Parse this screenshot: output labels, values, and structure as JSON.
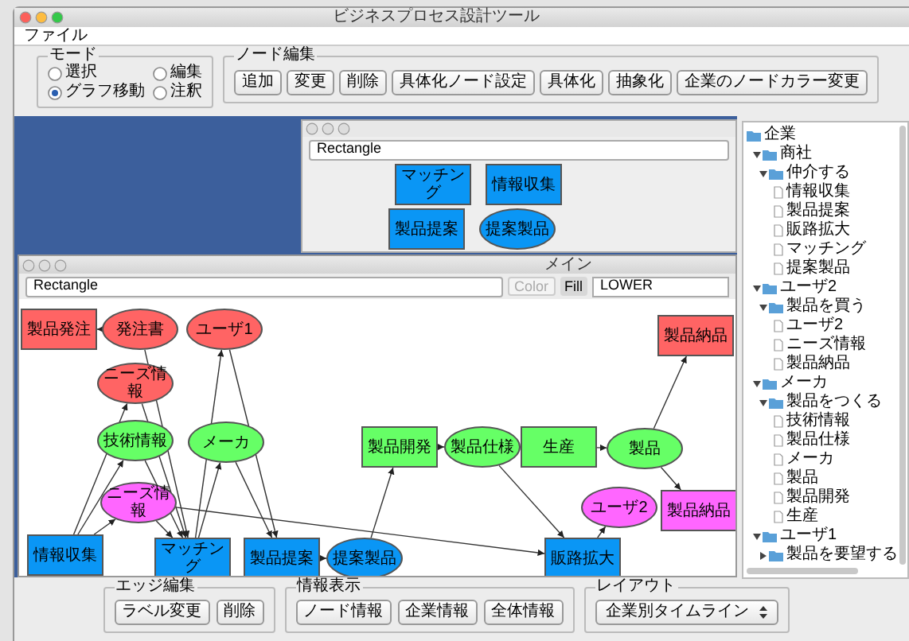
{
  "window": {
    "title": "ビジネスプロセス設計ツール"
  },
  "menu": [
    "ファイル"
  ],
  "mode": {
    "label": "モード",
    "options": [
      {
        "label": "選択",
        "selected": false
      },
      {
        "label": "編集",
        "selected": false
      },
      {
        "label": "グラフ移動",
        "selected": true
      },
      {
        "label": "注釈",
        "selected": false
      }
    ]
  },
  "node_edit": {
    "label": "ノード編集",
    "buttons": [
      "追加",
      "変更",
      "削除",
      "具体化ノード設定",
      "具体化",
      "抽象化",
      "企業のノードカラー変更"
    ]
  },
  "back_frame": {
    "shape": "Rectangle",
    "nodes": [
      {
        "label": "マッチング",
        "kind": "rect",
        "color": "#0a96f5"
      },
      {
        "label": "情報収集",
        "kind": "rect",
        "color": "#0a96f5"
      },
      {
        "label": "製品提案",
        "kind": "rect",
        "color": "#0a96f5"
      },
      {
        "label": "提案製品",
        "kind": "ellipse",
        "color": "#0a96f5"
      }
    ]
  },
  "main_frame": {
    "title": "メイン",
    "shape": "Rectangle",
    "color_button": {
      "label": "Color",
      "disabled": true
    },
    "fill_button": "Fill",
    "layer": "LOWER",
    "nodes": [
      {
        "label": "製品発注",
        "kind": "rect",
        "color": "#ff6464"
      },
      {
        "label": "発注書",
        "kind": "ellipse",
        "color": "#ff6464"
      },
      {
        "label": "ユーザ1",
        "kind": "ellipse",
        "color": "#ff6464"
      },
      {
        "label": "製品納品",
        "kind": "rect",
        "color": "#ff6464"
      },
      {
        "label": "ニーズ情報",
        "kind": "ellipse",
        "color": "#ff6464"
      },
      {
        "label": "技術情報",
        "kind": "ellipse",
        "color": "#66ff66"
      },
      {
        "label": "メーカ",
        "kind": "ellipse",
        "color": "#66ff66"
      },
      {
        "label": "製品開発",
        "kind": "rect",
        "color": "#66ff66"
      },
      {
        "label": "製品仕様",
        "kind": "ellipse",
        "color": "#66ff66"
      },
      {
        "label": "生産",
        "kind": "rect",
        "color": "#66ff66"
      },
      {
        "label": "製品",
        "kind": "ellipse",
        "color": "#66ff66"
      },
      {
        "label": "ニーズ情報",
        "kind": "ellipse",
        "color": "#ff66ff"
      },
      {
        "label": "ユーザ2",
        "kind": "ellipse",
        "color": "#ff66ff"
      },
      {
        "label": "製品納品",
        "kind": "rect",
        "color": "#ff66ff"
      },
      {
        "label": "情報収集",
        "kind": "rect",
        "color": "#0a96f5"
      },
      {
        "label": "マッチング",
        "kind": "rect",
        "color": "#0a96f5"
      },
      {
        "label": "製品提案",
        "kind": "rect",
        "color": "#0a96f5"
      },
      {
        "label": "提案製品",
        "kind": "ellipse",
        "color": "#0a96f5"
      },
      {
        "label": "販路拡大",
        "kind": "rect",
        "color": "#0a96f5"
      }
    ]
  },
  "tree": {
    "label": "企業",
    "kind": "folder",
    "children": [
      {
        "label": "商社",
        "kind": "folder",
        "expanded": true,
        "children": [
          {
            "label": "仲介する",
            "kind": "folder",
            "expanded": true,
            "children": [
              {
                "label": "情報収集",
                "kind": "leaf"
              },
              {
                "label": "製品提案",
                "kind": "leaf"
              },
              {
                "label": "販路拡大",
                "kind": "leaf"
              },
              {
                "label": "マッチング",
                "kind": "leaf"
              },
              {
                "label": "提案製品",
                "kind": "leaf"
              }
            ]
          }
        ]
      },
      {
        "label": "ユーザ2",
        "kind": "folder",
        "expanded": true,
        "children": [
          {
            "label": "製品を買う",
            "kind": "folder",
            "expanded": true,
            "children": [
              {
                "label": "ユーザ2",
                "kind": "leaf"
              },
              {
                "label": "ニーズ情報",
                "kind": "leaf"
              },
              {
                "label": "製品納品",
                "kind": "leaf"
              }
            ]
          }
        ]
      },
      {
        "label": "メーカ",
        "kind": "folder",
        "expanded": true,
        "children": [
          {
            "label": "製品をつくる",
            "kind": "folder",
            "expanded": true,
            "children": [
              {
                "label": "技術情報",
                "kind": "leaf"
              },
              {
                "label": "製品仕様",
                "kind": "leaf"
              },
              {
                "label": "メーカ",
                "kind": "leaf"
              },
              {
                "label": "製品",
                "kind": "leaf"
              },
              {
                "label": "製品開発",
                "kind": "leaf"
              },
              {
                "label": "生産",
                "kind": "leaf"
              }
            ]
          }
        ]
      },
      {
        "label": "ユーザ1",
        "kind": "folder",
        "expanded": true,
        "children": [
          {
            "label": "製品を要望する",
            "kind": "folder",
            "expanded": false
          }
        ]
      }
    ]
  },
  "edge_edit": {
    "label": "エッジ編集",
    "buttons": [
      "ラベル変更",
      "削除"
    ]
  },
  "info": {
    "label": "情報表示",
    "buttons": [
      "ノード情報",
      "企業情報",
      "全体情報"
    ]
  },
  "layout": {
    "label": "レイアウト",
    "value": "企業別タイムライン"
  }
}
